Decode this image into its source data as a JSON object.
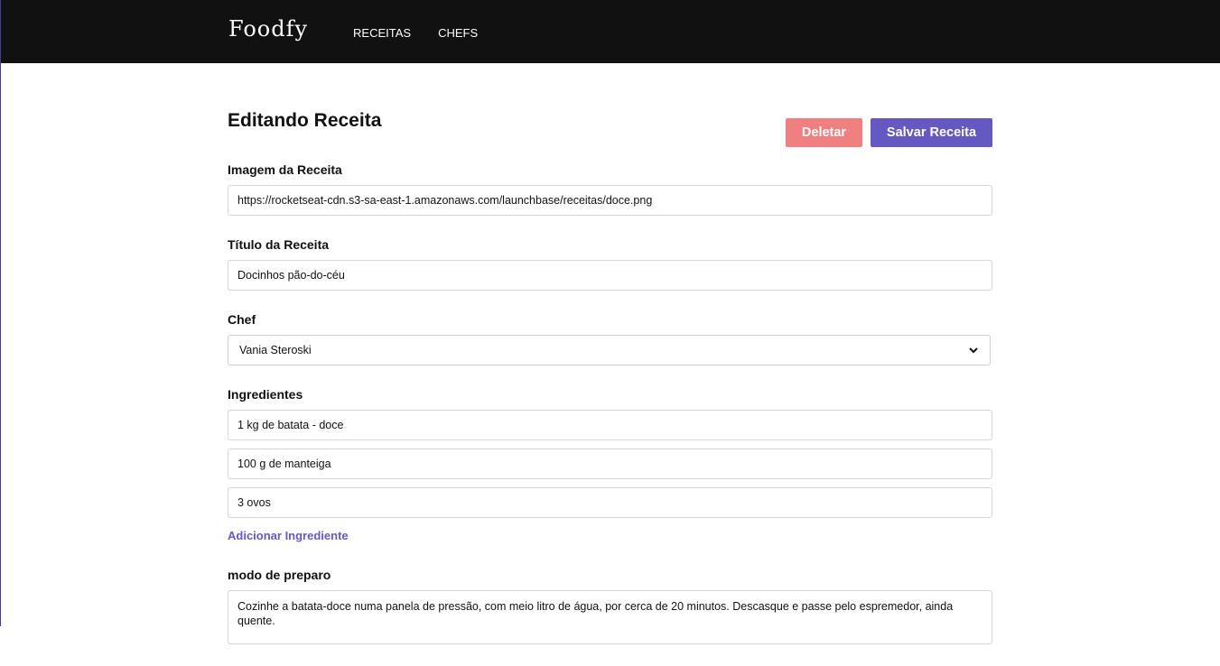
{
  "header": {
    "logo": "Foodfy",
    "nav": [
      "RECEITAS",
      "CHEFS"
    ]
  },
  "page": {
    "title": "Editando Receita",
    "delete_label": "Deletar",
    "save_label": "Salvar Receita"
  },
  "fields": {
    "image_label": "Imagem da Receita",
    "image_value": "https://rocketseat-cdn.s3-sa-east-1.amazonaws.com/launchbase/receitas/doce.png",
    "title_label": "Título da Receita",
    "title_value": "Docinhos pão-do-céu",
    "chef_label": "Chef",
    "chef_value": "Vania Steroski",
    "ingredients_label": "Ingredientes",
    "ingredients": [
      "1 kg de batata - doce",
      "100 g de manteiga",
      "3 ovos"
    ],
    "add_ingredient_label": "Adicionar Ingrediente",
    "prep_label": "modo de preparo",
    "prep_value": "Cozinhe a batata-doce numa panela de pressão, com meio litro de água, por cerca de 20 minutos. Descasque e passe pelo espremedor, ainda quente."
  },
  "colors": {
    "header_bg": "#111111",
    "accent": "#6558c3",
    "delete": "#f08080"
  }
}
